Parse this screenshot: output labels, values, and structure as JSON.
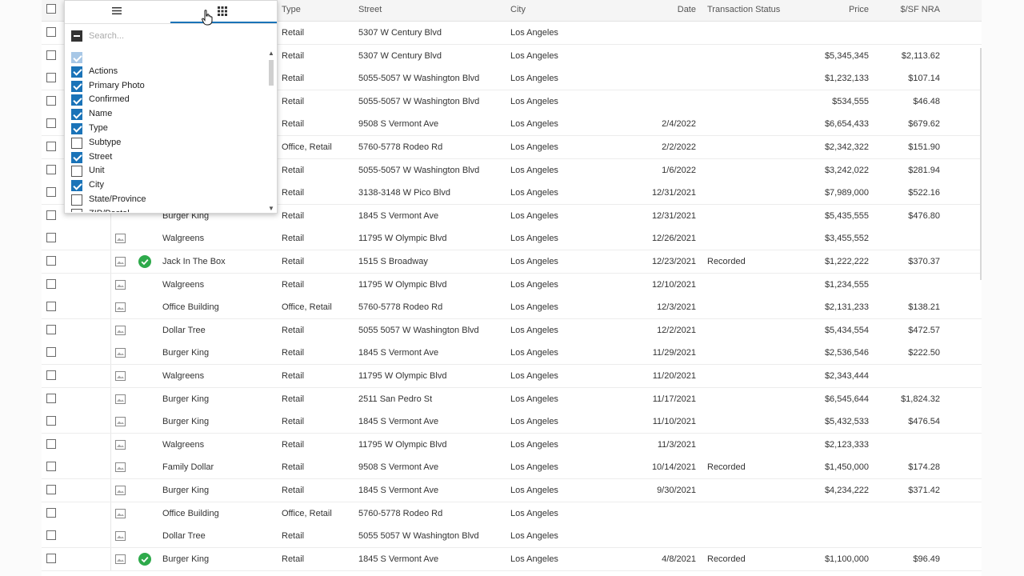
{
  "header": {
    "type": "Type",
    "street": "Street",
    "city": "City",
    "date": "Date",
    "status": "Transaction Status",
    "price": "Price",
    "psf": "$/SF NRA"
  },
  "column_panel": {
    "general_tab_icon": "menu-icon",
    "columns_tab_icon": "grid-icon",
    "search_placeholder": "Search...",
    "items": [
      {
        "label": "",
        "checked": "faded"
      },
      {
        "label": "Actions",
        "checked": "on"
      },
      {
        "label": "Primary Photo",
        "checked": "on"
      },
      {
        "label": "Confirmed",
        "checked": "on"
      },
      {
        "label": "Name",
        "checked": "on"
      },
      {
        "label": "Type",
        "checked": "on"
      },
      {
        "label": "Subtype",
        "checked": "off"
      },
      {
        "label": "Street",
        "checked": "on"
      },
      {
        "label": "Unit",
        "checked": "off"
      },
      {
        "label": "City",
        "checked": "on"
      },
      {
        "label": "State/Province",
        "checked": "off"
      },
      {
        "label": "ZIP/Postal",
        "checked": "off"
      }
    ]
  },
  "rows": [
    {
      "name": "",
      "photo": false,
      "confirmed": false,
      "type": "Retail",
      "street": "5307 W Century Blvd",
      "city": "Los Angeles",
      "date": "",
      "status": "",
      "price": "",
      "psf": ""
    },
    {
      "name": "",
      "photo": false,
      "confirmed": false,
      "type": "Retail",
      "street": "5307 W Century Blvd",
      "city": "Los Angeles",
      "date": "",
      "status": "",
      "price": "$5,345,345",
      "psf": "$2,113.62"
    },
    {
      "name": "",
      "photo": false,
      "confirmed": false,
      "type": "Retail",
      "street": "5055-5057 W Washington Blvd",
      "city": "Los Angeles",
      "date": "",
      "status": "",
      "price": "$1,232,133",
      "psf": "$107.14"
    },
    {
      "name": "",
      "photo": false,
      "confirmed": false,
      "type": "Retail",
      "street": "5055-5057 W Washington Blvd",
      "city": "Los Angeles",
      "date": "",
      "status": "",
      "price": "$534,555",
      "psf": "$46.48"
    },
    {
      "name": "",
      "photo": false,
      "confirmed": false,
      "type": "Retail",
      "street": "9508 S Vermont Ave",
      "city": "Los Angeles",
      "date": "2/4/2022",
      "status": "",
      "price": "$6,654,433",
      "psf": "$679.62"
    },
    {
      "name": "",
      "photo": false,
      "confirmed": false,
      "type": "Office, Retail",
      "street": "5760-5778 Rodeo Rd",
      "city": "Los Angeles",
      "date": "2/2/2022",
      "status": "",
      "price": "$2,342,322",
      "psf": "$151.90"
    },
    {
      "name": "",
      "photo": false,
      "confirmed": false,
      "type": "Retail",
      "street": "5055-5057 W Washington Blvd",
      "city": "Los Angeles",
      "date": "1/6/2022",
      "status": "",
      "price": "$3,242,022",
      "psf": "$281.94"
    },
    {
      "name": "",
      "photo": false,
      "confirmed": false,
      "type": "Retail",
      "street": "3138-3148 W Pico Blvd",
      "city": "Los Angeles",
      "date": "12/31/2021",
      "status": "",
      "price": "$7,989,000",
      "psf": "$522.16"
    },
    {
      "name": "Burger King",
      "photo": false,
      "confirmed": false,
      "type": "Retail",
      "street": "1845 S Vermont Ave",
      "city": "Los Angeles",
      "date": "12/31/2021",
      "status": "",
      "price": "$5,435,555",
      "psf": "$476.80"
    },
    {
      "name": "Walgreens",
      "photo": true,
      "confirmed": false,
      "type": "Retail",
      "street": "11795 W Olympic Blvd",
      "city": "Los Angeles",
      "date": "12/26/2021",
      "status": "",
      "price": "$3,455,552",
      "psf": ""
    },
    {
      "name": "Jack In The Box",
      "photo": true,
      "confirmed": true,
      "type": "Retail",
      "street": "1515 S Broadway",
      "city": "Los Angeles",
      "date": "12/23/2021",
      "status": "Recorded",
      "price": "$1,222,222",
      "psf": "$370.37"
    },
    {
      "name": "Walgreens",
      "photo": true,
      "confirmed": false,
      "type": "Retail",
      "street": "11795 W Olympic Blvd",
      "city": "Los Angeles",
      "date": "12/10/2021",
      "status": "",
      "price": "$1,234,555",
      "psf": ""
    },
    {
      "name": "Office Building",
      "photo": true,
      "confirmed": false,
      "type": "Office, Retail",
      "street": "5760-5778 Rodeo Rd",
      "city": "Los Angeles",
      "date": "12/3/2021",
      "status": "",
      "price": "$2,131,233",
      "psf": "$138.21"
    },
    {
      "name": "Dollar Tree",
      "photo": true,
      "confirmed": false,
      "type": "Retail",
      "street": "5055 5057 W Washington Blvd",
      "city": "Los Angeles",
      "date": "12/2/2021",
      "status": "",
      "price": "$5,434,554",
      "psf": "$472.57"
    },
    {
      "name": "Burger King",
      "photo": true,
      "confirmed": false,
      "type": "Retail",
      "street": "1845 S Vermont Ave",
      "city": "Los Angeles",
      "date": "11/29/2021",
      "status": "",
      "price": "$2,536,546",
      "psf": "$222.50"
    },
    {
      "name": "Walgreens",
      "photo": true,
      "confirmed": false,
      "type": "Retail",
      "street": "11795 W Olympic Blvd",
      "city": "Los Angeles",
      "date": "11/20/2021",
      "status": "",
      "price": "$2,343,444",
      "psf": ""
    },
    {
      "name": "Burger King",
      "photo": true,
      "confirmed": false,
      "type": "Retail",
      "street": "2511 San Pedro St",
      "city": "Los Angeles",
      "date": "11/17/2021",
      "status": "",
      "price": "$6,545,644",
      "psf": "$1,824.32"
    },
    {
      "name": "Burger King",
      "photo": true,
      "confirmed": false,
      "type": "Retail",
      "street": "1845 S Vermont Ave",
      "city": "Los Angeles",
      "date": "11/10/2021",
      "status": "",
      "price": "$5,432,533",
      "psf": "$476.54"
    },
    {
      "name": "Walgreens",
      "photo": true,
      "confirmed": false,
      "type": "Retail",
      "street": "11795 W Olympic Blvd",
      "city": "Los Angeles",
      "date": "11/3/2021",
      "status": "",
      "price": "$2,123,333",
      "psf": ""
    },
    {
      "name": "Family Dollar",
      "photo": true,
      "confirmed": false,
      "type": "Retail",
      "street": "9508 S Vermont Ave",
      "city": "Los Angeles",
      "date": "10/14/2021",
      "status": "Recorded",
      "price": "$1,450,000",
      "psf": "$174.28"
    },
    {
      "name": "Burger King",
      "photo": true,
      "confirmed": false,
      "type": "Retail",
      "street": "1845 S Vermont Ave",
      "city": "Los Angeles",
      "date": "9/30/2021",
      "status": "",
      "price": "$4,234,222",
      "psf": "$371.42"
    },
    {
      "name": "Office Building",
      "photo": true,
      "confirmed": false,
      "type": "Office, Retail",
      "street": "5760-5778 Rodeo Rd",
      "city": "Los Angeles",
      "date": "",
      "status": "",
      "price": "",
      "psf": ""
    },
    {
      "name": "Dollar Tree",
      "photo": true,
      "confirmed": false,
      "type": "Retail",
      "street": "5055 5057 W Washington Blvd",
      "city": "Los Angeles",
      "date": "",
      "status": "",
      "price": "",
      "psf": ""
    },
    {
      "name": "Burger King",
      "photo": true,
      "confirmed": true,
      "type": "Retail",
      "street": "1845 S Vermont Ave",
      "city": "Los Angeles",
      "date": "4/8/2021",
      "status": "Recorded",
      "price": "$1,100,000",
      "psf": "$96.49"
    }
  ],
  "colors": {
    "accent": "#1a73b8",
    "confirmed_green": "#2eaa4b",
    "header_bg": "#f5f5f5"
  }
}
